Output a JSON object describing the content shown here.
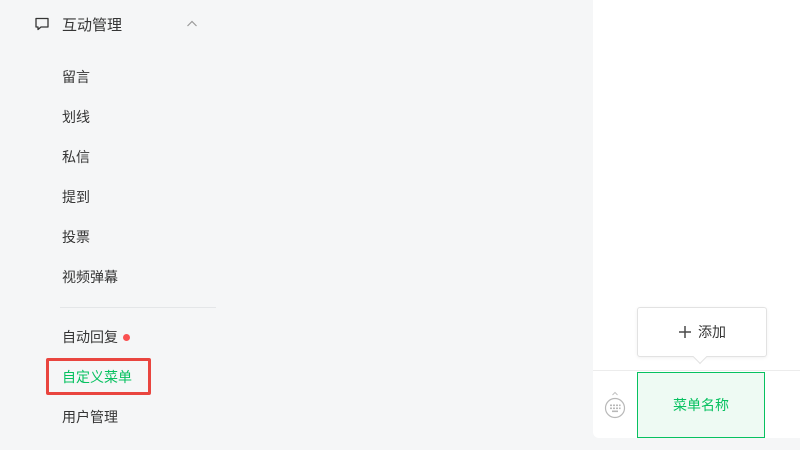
{
  "sidebar": {
    "group": {
      "title": "互动管理",
      "icon": "chat-icon",
      "expanded": true
    },
    "items": [
      {
        "label": "留言"
      },
      {
        "label": "划线"
      },
      {
        "label": "私信"
      },
      {
        "label": "提到"
      },
      {
        "label": "投票"
      },
      {
        "label": "视频弹幕"
      }
    ],
    "items2": [
      {
        "label": "自动回复",
        "has_dot": true
      },
      {
        "label": "自定义菜单",
        "active": true
      },
      {
        "label": "用户管理"
      }
    ]
  },
  "preview": {
    "add_label": "添加",
    "menu_name": "菜单名称",
    "left_icon": "keyboard-icon"
  },
  "colors": {
    "accent": "#07c160",
    "highlight": "#e9453f",
    "dot": "#fa5151"
  }
}
